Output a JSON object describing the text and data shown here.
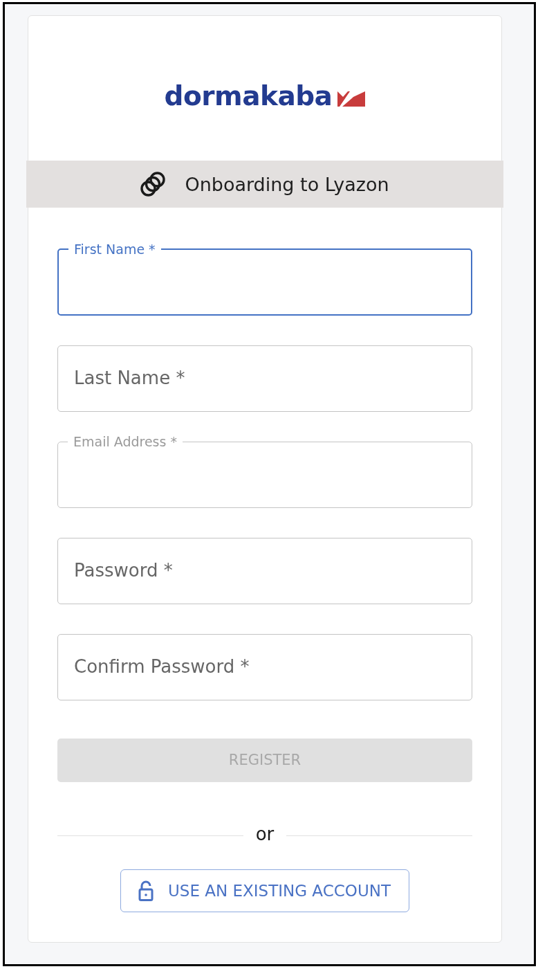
{
  "logo": {
    "text": "dormakaba"
  },
  "banner": {
    "title": "Onboarding to Lyazon"
  },
  "form": {
    "fields": [
      {
        "label": "First Name *",
        "focused": true,
        "label_raised": true
      },
      {
        "label": "Last Name *",
        "focused": false,
        "label_raised": false
      },
      {
        "label": "Email Address *",
        "focused": false,
        "label_raised": true
      },
      {
        "label": "Password *",
        "focused": false,
        "label_raised": false
      },
      {
        "label": "Confirm Password *",
        "focused": false,
        "label_raised": false
      }
    ],
    "register_button": {
      "label": "REGISTER",
      "disabled": true
    },
    "divider": {
      "text": "or"
    },
    "existing_account_button": {
      "label": "USE AN EXISTING ACCOUNT"
    }
  }
}
